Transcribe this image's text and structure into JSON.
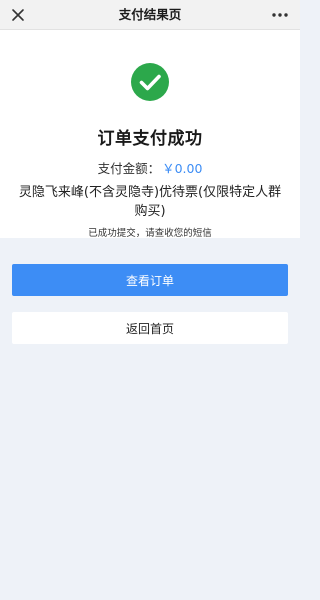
{
  "nav": {
    "title": "支付结果页",
    "close_icon": "close-icon",
    "more_icon": "more-dots-icon"
  },
  "result": {
    "status_icon": "success-check-icon",
    "title": "订单支付成功",
    "amount_label": "支付金额：",
    "amount_value": "￥0.00",
    "product_name": "灵隐飞来峰(不含灵隐寺)优待票(仅限特定人群购买)",
    "notice": "已成功提交，请查收您的短信"
  },
  "actions": {
    "view_order_label": "查看订单",
    "home_label": "返回首页"
  },
  "colors": {
    "accent": "#3d8df5",
    "success": "#2ca84b",
    "page_background": "#eef2f8"
  }
}
